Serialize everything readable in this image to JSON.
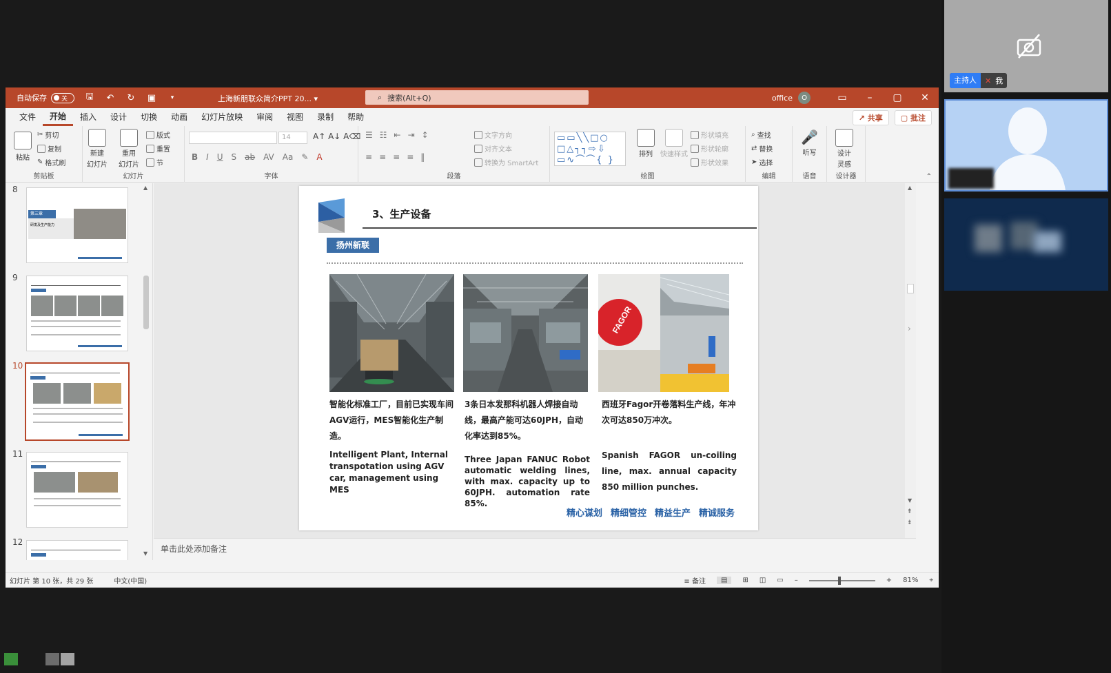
{
  "titlebar": {
    "autosave_label": "自动保存",
    "autosave_state": "关",
    "document_title": "上海新朋联众简介PPT 20...",
    "search_placeholder": "搜索(Alt+Q)",
    "account": "office",
    "account_initial": "O"
  },
  "tabs": [
    "文件",
    "开始",
    "插入",
    "设计",
    "切换",
    "动画",
    "幻灯片放映",
    "审阅",
    "视图",
    "录制",
    "帮助"
  ],
  "active_tab": "开始",
  "tab_actions": {
    "share": "共享",
    "comment": "批注"
  },
  "ribbon": {
    "clipboard": {
      "label": "剪贴板",
      "paste": "粘贴",
      "cut": "剪切",
      "copy": "复制",
      "format_painter": "格式刷"
    },
    "slides": {
      "label": "幻灯片",
      "new_slide": "新建",
      "new_slide2": "幻灯片",
      "reuse": "重用",
      "reuse2": "幻灯片",
      "layout": "版式",
      "reset": "重置",
      "section": "节"
    },
    "font": {
      "label": "字体",
      "size": "14"
    },
    "paragraph": {
      "label": "段落",
      "text_direction": "文字方向",
      "align_text": "对齐文本",
      "smartart": "转换为 SmartArt"
    },
    "drawing": {
      "label": "绘图",
      "arrange": "排列",
      "quick_styles": "快速样式",
      "fill": "形状填充",
      "outline": "形状轮廓",
      "effects": "形状效果"
    },
    "editing": {
      "label": "编辑",
      "find": "查找",
      "replace": "替换",
      "select": "选择"
    },
    "voice": {
      "label": "语音",
      "dictate": "听写"
    },
    "designer": {
      "label": "设计器",
      "ideas": "设计",
      "ideas2": "灵感"
    }
  },
  "thumbnails": [
    {
      "number": "8",
      "chapter": "第三章",
      "subtitle": "研发及生产能力"
    },
    {
      "number": "9"
    },
    {
      "number": "10",
      "active": true
    },
    {
      "number": "11"
    },
    {
      "number": "12"
    }
  ],
  "slide": {
    "title": "3、生产设备",
    "tag": "扬州新联",
    "columns": [
      {
        "cn": "智能化标准工厂，目前已实现车间AGV运行，MES智能化生产制造。",
        "en": "Intelligent Plant, Internal transpotation using AGV car, management using MES"
      },
      {
        "cn": "3条日本发那科机器人焊接自动线，最高产能可达60JPH，自动化率达到85%。",
        "en": "Three Japan FANUC Robot automatic welding lines, with max. capacity up to 60JPH. automation rate 85%."
      },
      {
        "cn": "西班牙Fagor开卷落料生产线，年冲次可达850万冲次。",
        "en": "Spanish FAGOR un-coiling line, max. annual capacity 850 million punches."
      }
    ],
    "photo3_brand": "FAGOR",
    "slogans": [
      "精心谋划",
      "精细管控",
      "精益生产",
      "精诚服务"
    ]
  },
  "notes_placeholder": "单击此处添加备注",
  "status": {
    "slide_info": "幻灯片 第 10 张，共 29 张",
    "language": "中文(中国)",
    "notes_button": "备注",
    "zoom": "81%"
  },
  "meeting": {
    "host_label": "主持人",
    "me_label": "我"
  },
  "colors": {
    "ppt_accent": "#b7472a",
    "slide_blue": "#3b6ea8",
    "host_blue": "#2f7df6"
  }
}
